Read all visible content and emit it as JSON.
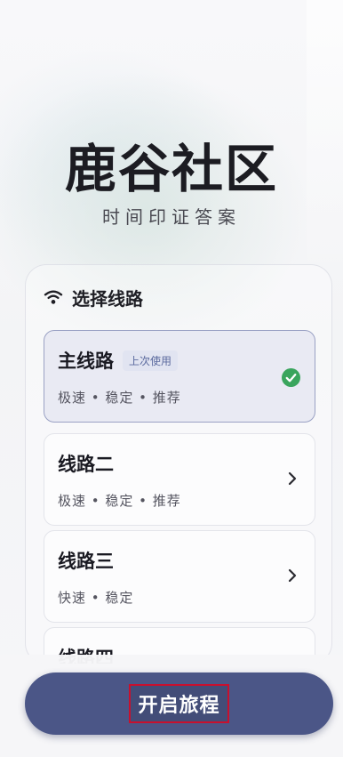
{
  "app": {
    "title": "鹿谷社区",
    "subtitle": "时间印证答案"
  },
  "route_panel": {
    "header": "选择线路",
    "header_icon": "wifi-icon",
    "routes": [
      {
        "name": "主线路",
        "badge": "上次使用",
        "tags": "极速 • 稳定 • 推荐",
        "selected": true,
        "indicator": "check-icon"
      },
      {
        "name": "线路二",
        "tags": "极速 • 稳定 • 推荐",
        "selected": false,
        "indicator": "chevron-right-icon"
      },
      {
        "name": "线路三",
        "tags": "快速 • 稳定",
        "selected": false,
        "indicator": "chevron-right-icon"
      },
      {
        "name": "线路四",
        "selected": false
      }
    ]
  },
  "action": {
    "start_label": "开启旅程"
  },
  "colors": {
    "primary": "#4b5687",
    "selected_border": "#9aa1c4",
    "check": "#3aa55d"
  }
}
